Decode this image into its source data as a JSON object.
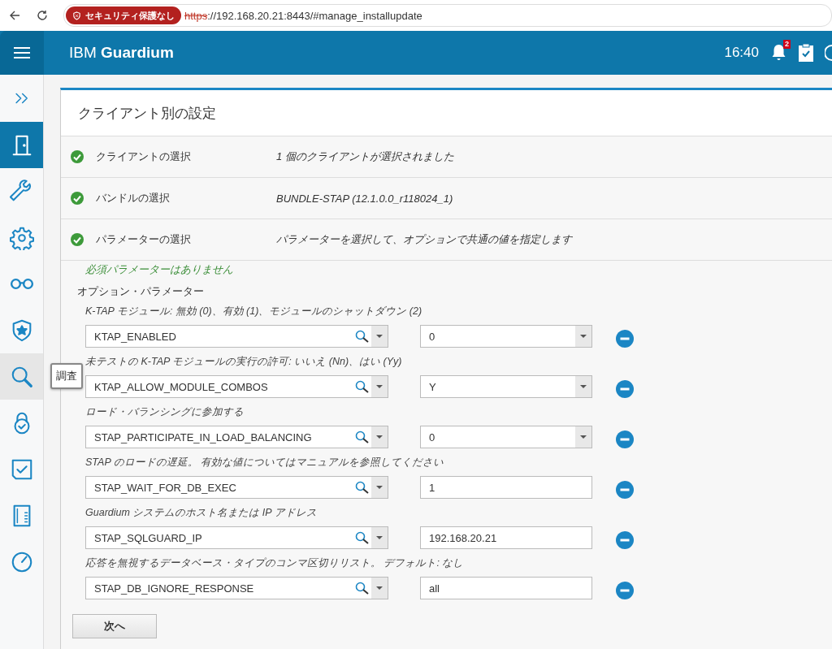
{
  "browser": {
    "security_badge": "セキュリティ保護なし",
    "url_scheme": "https",
    "url_rest": "://192.168.20.21:8443/#manage_installupdate"
  },
  "header": {
    "brand_light": "IBM",
    "brand_bold": "Guardium",
    "time": "16:40",
    "notification_count": "2"
  },
  "sidebar": {
    "items": [
      {
        "kind": "expand",
        "selected": false,
        "hovered": false
      },
      {
        "kind": "door",
        "selected": true,
        "hovered": false
      },
      {
        "kind": "wrench",
        "selected": false,
        "hovered": false
      },
      {
        "kind": "gear",
        "selected": false,
        "hovered": false
      },
      {
        "kind": "glasses",
        "selected": false,
        "hovered": false
      },
      {
        "kind": "shield",
        "selected": false,
        "hovered": false
      },
      {
        "kind": "search",
        "selected": false,
        "hovered": true
      },
      {
        "kind": "lock",
        "selected": false,
        "hovered": false
      },
      {
        "kind": "checklist",
        "selected": false,
        "hovered": false
      },
      {
        "kind": "report",
        "selected": false,
        "hovered": false
      },
      {
        "kind": "gauge",
        "selected": false,
        "hovered": false
      }
    ],
    "tooltip": "調査"
  },
  "panel": {
    "title": "クライアント別の設定",
    "steps": [
      {
        "label": "クライアントの選択",
        "value": "1 個のクライアントが選択されました",
        "done": true
      },
      {
        "label": "バンドルの選択",
        "value": "BUNDLE-STAP (12.1.0.0_r118024_1)",
        "done": true
      },
      {
        "label": "パラメーターの選択",
        "value": "パラメーターを選択して、オプションで共通の値を指定します",
        "done": true
      }
    ],
    "required_note": "必須パラメーターはありません",
    "optional_heading": "オプション・パラメーター",
    "parameters": [
      {
        "description": "K-TAP モジュール: 無効 (0)、有効 (1)、モジュールのシャットダウン (2)",
        "name": "KTAP_ENABLED",
        "kind": "select",
        "value": "0"
      },
      {
        "description": "未テストの K-TAP モジュールの実行の許可: いいえ (Nn)、はい (Yy)",
        "name": "KTAP_ALLOW_MODULE_COMBOS",
        "kind": "select",
        "value": "Y"
      },
      {
        "description": "ロード・バランシングに参加する",
        "name": "STAP_PARTICIPATE_IN_LOAD_BALANCING",
        "kind": "select",
        "value": "0"
      },
      {
        "description": "STAP のロードの遅延。 有効な値についてはマニュアルを参照してください",
        "name": "STAP_WAIT_FOR_DB_EXEC",
        "kind": "text",
        "value": "1"
      },
      {
        "description": "Guardium システムのホスト名または IP アドレス",
        "name": "STAP_SQLGUARD_IP",
        "kind": "text",
        "value": "192.168.20.21"
      },
      {
        "description": "応答を無視するデータベース・タイプのコンマ区切りリスト。 デフォルト: なし",
        "name": "STAP_DB_IGNORE_RESPONSE",
        "kind": "text",
        "value": "all"
      }
    ],
    "next_button": "次へ"
  }
}
